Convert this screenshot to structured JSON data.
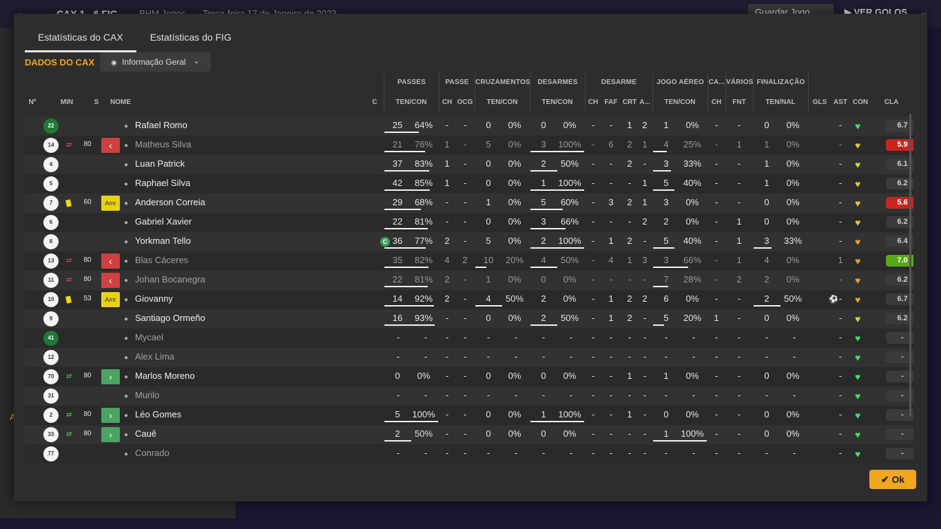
{
  "background": {
    "back_icon": "arrow-left-icon",
    "score": "CAX 1 - 6 FIG",
    "subtitle": "BHM Jogos",
    "date": "Terça-feira 17 de Janeiro de 2023",
    "save_label": "Guardar Jogo",
    "view_label": "VER GOLOS",
    "side_letter": "A"
  },
  "dialog": {
    "tabs": [
      "Estatísticas do CAX",
      "Estatísticas do FIG"
    ],
    "section_title": "DADOS DO CAX",
    "dropdown_value": "Informação Geral",
    "ok_label": "Ok"
  },
  "groups": {
    "passes": "PASSES",
    "passe": "PASSE",
    "cruz": "CRUZAMENTOS",
    "desarmes": "DESARMES",
    "desarme": "DESARME",
    "aereo": "JOGO AÉREO",
    "ca": "CA...",
    "varios": "VÁRIOS",
    "final": "FINALIZAÇÃO"
  },
  "headers": {
    "num": "Nº",
    "min": "MIN",
    "s": "S",
    "name": "NOME",
    "c": "C",
    "passes": "TEN/CON",
    "ch1": "CH",
    "ocg": "OCG",
    "cruz": "TEN/CON",
    "des": "TEN/CON",
    "ch2": "CH",
    "faf": "FAF",
    "crt": "CRT",
    "a": "A...",
    "aer": "TEN/CON",
    "ch3": "CH",
    "fnt": "FNT",
    "fin": "TEN/NAL",
    "gls": "GLS",
    "ast": "AST",
    "con": "CON",
    "cla": "CLA"
  },
  "players": [
    {
      "num": "22",
      "gk": true,
      "min": "",
      "subtype": "",
      "card": "",
      "badge": "",
      "name": "Rafael Romo",
      "dim": false,
      "cap": false,
      "p": [
        "25",
        "64%"
      ],
      "pbar": 0.64,
      "ch1": "-",
      "ocg": "-",
      "cr": [
        "0",
        "0%"
      ],
      "crbar": 0,
      "de": [
        "0",
        "0%"
      ],
      "debar": 0,
      "ch2": "-",
      "faf": "-",
      "crt": "1",
      "a": "2",
      "ae": [
        "1",
        "0%"
      ],
      "aebar": 0,
      "ch3": "-",
      "fnt": "-",
      "fi": [
        "0",
        "0%"
      ],
      "fibar": 0,
      "gls": "",
      "ast": "-",
      "con": "green",
      "cla": "6.7",
      "clatype": ""
    },
    {
      "num": "14",
      "gk": false,
      "min": "80",
      "subtype": "out",
      "card": "",
      "badge": "red",
      "name": "Matheus Silva",
      "dim": true,
      "cap": false,
      "p": [
        "21",
        "76%"
      ],
      "pbar": 0.76,
      "ch1": "1",
      "ocg": "-",
      "cr": [
        "5",
        "0%"
      ],
      "crbar": 0,
      "de": [
        "3",
        "100%"
      ],
      "debar": 1,
      "ch2": "-",
      "faf": "6",
      "crt": "2",
      "a": "1",
      "ae": [
        "4",
        "25%"
      ],
      "aebar": 0.25,
      "ch3": "-",
      "fnt": "1",
      "fi": [
        "1",
        "0%"
      ],
      "fibar": 0,
      "gls": "",
      "ast": "-",
      "con": "yellow",
      "cla": "5.9",
      "clatype": "bad"
    },
    {
      "num": "4",
      "gk": false,
      "min": "",
      "subtype": "",
      "card": "",
      "badge": "",
      "name": "Luan Patrick",
      "dim": false,
      "cap": false,
      "p": [
        "37",
        "83%"
      ],
      "pbar": 0.83,
      "ch1": "1",
      "ocg": "-",
      "cr": [
        "0",
        "0%"
      ],
      "crbar": 0,
      "de": [
        "2",
        "50%"
      ],
      "debar": 0.5,
      "ch2": "-",
      "faf": "-",
      "crt": "2",
      "a": "-",
      "ae": [
        "3",
        "33%"
      ],
      "aebar": 0.33,
      "ch3": "-",
      "fnt": "-",
      "fi": [
        "1",
        "0%"
      ],
      "fibar": 0,
      "gls": "",
      "ast": "-",
      "con": "lime",
      "cla": "6.1",
      "clatype": ""
    },
    {
      "num": "5",
      "gk": false,
      "min": "",
      "subtype": "",
      "card": "",
      "badge": "",
      "name": "Raphael Silva",
      "dim": false,
      "cap": false,
      "p": [
        "42",
        "85%"
      ],
      "pbar": 0.85,
      "ch1": "1",
      "ocg": "-",
      "cr": [
        "0",
        "0%"
      ],
      "crbar": 0,
      "de": [
        "1",
        "100%"
      ],
      "debar": 1,
      "ch2": "-",
      "faf": "-",
      "crt": "-",
      "a": "1",
      "ae": [
        "5",
        "40%"
      ],
      "aebar": 0.4,
      "ch3": "-",
      "fnt": "-",
      "fi": [
        "1",
        "0%"
      ],
      "fibar": 0,
      "gls": "",
      "ast": "-",
      "con": "yellow",
      "cla": "6.2",
      "clatype": ""
    },
    {
      "num": "7",
      "gk": false,
      "min": "60",
      "subtype": "",
      "card": "yellow",
      "badge": "amr",
      "name": "Anderson Correia",
      "dim": false,
      "cap": false,
      "p": [
        "29",
        "68%"
      ],
      "pbar": 0.68,
      "ch1": "-",
      "ocg": "-",
      "cr": [
        "1",
        "0%"
      ],
      "crbar": 0,
      "de": [
        "5",
        "60%"
      ],
      "debar": 0.6,
      "ch2": "-",
      "faf": "3",
      "crt": "2",
      "a": "1",
      "ae": [
        "3",
        "0%"
      ],
      "aebar": 0,
      "ch3": "-",
      "fnt": "-",
      "fi": [
        "0",
        "0%"
      ],
      "fibar": 0,
      "gls": "",
      "ast": "-",
      "con": "yellow",
      "cla": "5.6",
      "clatype": "bad"
    },
    {
      "num": "6",
      "gk": false,
      "min": "",
      "subtype": "",
      "card": "",
      "badge": "",
      "name": "Gabriel Xavier",
      "dim": false,
      "cap": false,
      "p": [
        "22",
        "81%"
      ],
      "pbar": 0.81,
      "ch1": "-",
      "ocg": "-",
      "cr": [
        "0",
        "0%"
      ],
      "crbar": 0,
      "de": [
        "3",
        "66%"
      ],
      "debar": 0.66,
      "ch2": "-",
      "faf": "-",
      "crt": "-",
      "a": "2",
      "ae": [
        "2",
        "0%"
      ],
      "aebar": 0,
      "ch3": "-",
      "fnt": "1",
      "fi": [
        "0",
        "0%"
      ],
      "fibar": 0,
      "gls": "",
      "ast": "-",
      "con": "yellow",
      "cla": "6.2",
      "clatype": ""
    },
    {
      "num": "8",
      "gk": false,
      "min": "",
      "subtype": "",
      "card": "",
      "badge": "",
      "name": "Yorkman Tello",
      "dim": false,
      "cap": true,
      "p": [
        "36",
        "77%"
      ],
      "pbar": 0.77,
      "ch1": "2",
      "ocg": "-",
      "cr": [
        "5",
        "0%"
      ],
      "crbar": 0,
      "de": [
        "2",
        "100%"
      ],
      "debar": 1,
      "ch2": "-",
      "faf": "1",
      "crt": "2",
      "a": "-",
      "ae": [
        "5",
        "40%"
      ],
      "aebar": 0.4,
      "ch3": "-",
      "fnt": "1",
      "fi": [
        "3",
        "33%"
      ],
      "fibar": 0.33,
      "gls": "",
      "ast": "-",
      "con": "orange",
      "cla": "6.4",
      "clatype": ""
    },
    {
      "num": "13",
      "gk": false,
      "min": "80",
      "subtype": "out",
      "card": "",
      "badge": "red",
      "name": "Blas Cáceres",
      "dim": true,
      "cap": false,
      "p": [
        "35",
        "82%"
      ],
      "pbar": 0.82,
      "ch1": "4",
      "ocg": "2",
      "cr": [
        "10",
        "20%"
      ],
      "crbar": 0.2,
      "de": [
        "4",
        "50%"
      ],
      "debar": 0.5,
      "ch2": "-",
      "faf": "4",
      "crt": "1",
      "a": "3",
      "ae": [
        "3",
        "66%"
      ],
      "aebar": 0.66,
      "ch3": "-",
      "fnt": "1",
      "fi": [
        "4",
        "0%"
      ],
      "fibar": 0,
      "gls": "",
      "ast": "1",
      "con": "orange",
      "cla": "7.0",
      "clatype": "good"
    },
    {
      "num": "11",
      "gk": false,
      "min": "80",
      "subtype": "out",
      "card": "",
      "badge": "red",
      "name": "Johan Bocanegra",
      "dim": true,
      "cap": false,
      "p": [
        "22",
        "81%"
      ],
      "pbar": 0.81,
      "ch1": "2",
      "ocg": "-",
      "cr": [
        "1",
        "0%"
      ],
      "crbar": 0,
      "de": [
        "0",
        "0%"
      ],
      "debar": 0,
      "ch2": "-",
      "faf": "-",
      "crt": "-",
      "a": "-",
      "ae": [
        "7",
        "28%"
      ],
      "aebar": 0.28,
      "ch3": "-",
      "fnt": "2",
      "fi": [
        "2",
        "0%"
      ],
      "fibar": 0,
      "gls": "",
      "ast": "-",
      "con": "orange",
      "cla": "6.2",
      "clatype": ""
    },
    {
      "num": "10",
      "gk": false,
      "min": "53",
      "subtype": "",
      "card": "yellow",
      "badge": "amr",
      "name": "Giovanny",
      "dim": false,
      "cap": false,
      "p": [
        "14",
        "92%"
      ],
      "pbar": 0.92,
      "ch1": "2",
      "ocg": "-",
      "cr": [
        "4",
        "50%"
      ],
      "crbar": 0.5,
      "de": [
        "2",
        "0%"
      ],
      "debar": 0,
      "ch2": "-",
      "faf": "1",
      "crt": "2",
      "a": "2",
      "ae": [
        "6",
        "0%"
      ],
      "aebar": 0,
      "ch3": "-",
      "fnt": "-",
      "fi": [
        "2",
        "50%"
      ],
      "fibar": 0.5,
      "gls": "ball",
      "ast": "-",
      "con": "orange",
      "cla": "6.7",
      "clatype": ""
    },
    {
      "num": "9",
      "gk": false,
      "min": "",
      "subtype": "",
      "card": "",
      "badge": "",
      "name": "Santiago Ormeño",
      "dim": false,
      "cap": false,
      "p": [
        "16",
        "93%"
      ],
      "pbar": 0.93,
      "ch1": "-",
      "ocg": "-",
      "cr": [
        "0",
        "0%"
      ],
      "crbar": 0,
      "de": [
        "2",
        "50%"
      ],
      "debar": 0.5,
      "ch2": "-",
      "faf": "1",
      "crt": "2",
      "a": "-",
      "ae": [
        "5",
        "20%"
      ],
      "aebar": 0.2,
      "ch3": "1",
      "fnt": "-",
      "fi": [
        "0",
        "0%"
      ],
      "fibar": 0,
      "gls": "",
      "ast": "-",
      "con": "lime",
      "cla": "6.2",
      "clatype": ""
    },
    {
      "num": "41",
      "gk": true,
      "min": "",
      "subtype": "",
      "card": "",
      "badge": "",
      "name": "Mycael",
      "dim": true,
      "cap": false,
      "empty": true,
      "con": "green",
      "cla": "-",
      "clatype": ""
    },
    {
      "num": "12",
      "gk": false,
      "min": "",
      "subtype": "",
      "card": "",
      "badge": "",
      "name": "Alex Lima",
      "dim": true,
      "cap": false,
      "empty": true,
      "con": "green",
      "cla": "-",
      "clatype": ""
    },
    {
      "num": "70",
      "gk": false,
      "min": "80",
      "subtype": "in",
      "card": "",
      "badge": "green",
      "name": "Marlos Moreno",
      "dim": false,
      "cap": false,
      "p": [
        "0",
        "0%"
      ],
      "pbar": 0,
      "ch1": "-",
      "ocg": "-",
      "cr": [
        "0",
        "0%"
      ],
      "crbar": 0,
      "de": [
        "0",
        "0%"
      ],
      "debar": 0,
      "ch2": "-",
      "faf": "-",
      "crt": "1",
      "a": "-",
      "ae": [
        "1",
        "0%"
      ],
      "aebar": 0,
      "ch3": "-",
      "fnt": "-",
      "fi": [
        "0",
        "0%"
      ],
      "fibar": 0,
      "gls": "",
      "ast": "-",
      "con": "green",
      "cla": "-",
      "clatype": ""
    },
    {
      "num": "31",
      "gk": false,
      "min": "",
      "subtype": "",
      "card": "",
      "badge": "",
      "name": "Murilo",
      "dim": true,
      "cap": false,
      "empty": true,
      "con": "green",
      "cla": "-",
      "clatype": ""
    },
    {
      "num": "2",
      "gk": false,
      "min": "80",
      "subtype": "in",
      "card": "",
      "badge": "green",
      "name": "Léo Gomes",
      "dim": false,
      "cap": false,
      "p": [
        "5",
        "100%"
      ],
      "pbar": 1,
      "ch1": "-",
      "ocg": "-",
      "cr": [
        "0",
        "0%"
      ],
      "crbar": 0,
      "de": [
        "1",
        "100%"
      ],
      "debar": 1,
      "ch2": "-",
      "faf": "-",
      "crt": "1",
      "a": "-",
      "ae": [
        "0",
        "0%"
      ],
      "aebar": 0,
      "ch3": "-",
      "fnt": "-",
      "fi": [
        "0",
        "0%"
      ],
      "fibar": 0,
      "gls": "",
      "ast": "-",
      "con": "green",
      "cla": "-",
      "clatype": ""
    },
    {
      "num": "33",
      "gk": false,
      "min": "80",
      "subtype": "in",
      "card": "",
      "badge": "green",
      "name": "Cauê",
      "dim": false,
      "cap": false,
      "p": [
        "2",
        "50%"
      ],
      "pbar": 0.5,
      "ch1": "-",
      "ocg": "-",
      "cr": [
        "0",
        "0%"
      ],
      "crbar": 0,
      "de": [
        "0",
        "0%"
      ],
      "debar": 0,
      "ch2": "-",
      "faf": "-",
      "crt": "-",
      "a": "-",
      "ae": [
        "1",
        "100%"
      ],
      "aebar": 1,
      "ch3": "-",
      "fnt": "-",
      "fi": [
        "0",
        "0%"
      ],
      "fibar": 0,
      "gls": "",
      "ast": "-",
      "con": "green",
      "cla": "-",
      "clatype": ""
    },
    {
      "num": "77",
      "gk": false,
      "min": "",
      "subtype": "",
      "card": "",
      "badge": "",
      "name": "Conrado",
      "dim": true,
      "cap": false,
      "empty": true,
      "con": "green",
      "cla": "-",
      "clatype": ""
    }
  ],
  "colors": {
    "accent": "#f0a61e",
    "heart_green": "#3ee06a",
    "heart_lime": "#b8e03a",
    "heart_yellow": "#e8c830",
    "heart_orange": "#e8a030",
    "rating_bad": "#c7261e",
    "rating_good": "#5aa81a"
  },
  "icons": {
    "eye": "eye-icon",
    "chevron": "chevron-down-icon",
    "person": "person-icon",
    "ball": "football-icon",
    "check": "check-icon",
    "heart": "heart-icon"
  }
}
